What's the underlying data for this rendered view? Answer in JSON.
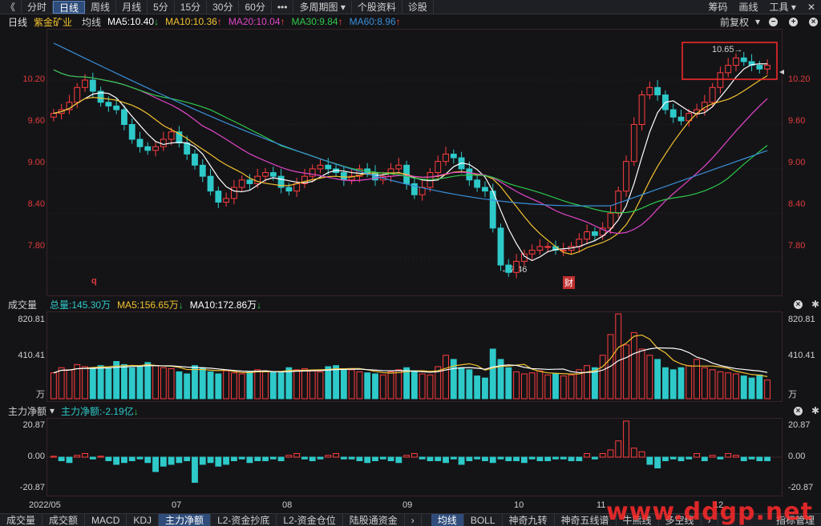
{
  "toolbar": {
    "back_icon": "《",
    "periods": [
      "分时",
      "日线",
      "周线",
      "月线",
      "5分",
      "15分",
      "30分",
      "60分"
    ],
    "active_period": "日线",
    "more_label": "•••",
    "multi_cycle_label": "多周期图",
    "stock_info_label": "个股资料",
    "diagnose_label": "诊股",
    "chips_label": "筹码",
    "draw_label": "画线",
    "tools_label": "工具"
  },
  "main_info": {
    "period": "日线",
    "stock_name": "紫金矿业",
    "ma_label": "均线",
    "ma5": "MA5:10.40",
    "ma10": "MA10:10.36",
    "ma20": "MA20:10.04",
    "ma30": "MA30:9.84",
    "ma60": "MA60:8.96",
    "adjust_label": "前复权",
    "colors": {
      "ma5": "#ffffff",
      "ma10": "#f2c12e",
      "ma20": "#e146c8",
      "ma30": "#2ec94a",
      "ma60": "#3a8fd8"
    }
  },
  "price_axis": {
    "ticks": [
      "10.20",
      "9.60",
      "9.00",
      "8.40",
      "7.80"
    ],
    "high_annotation": "10.65→",
    "low_annotation": "←7.46",
    "marker_q": "q",
    "marker_cai": "财"
  },
  "volume_info": {
    "title": "成交量",
    "total": "总量:145.30万",
    "ma5": "MA5:156.65万",
    "ma10": "MA10:172.86万",
    "ticks": [
      "820.81",
      "410.41",
      "万"
    ]
  },
  "flow_info": {
    "title": "主力净额",
    "value": "主力净额:-2.19亿",
    "ticks": [
      "20.87",
      "0.00",
      "-20.87"
    ]
  },
  "date_axis": [
    "2022/05",
    "07",
    "08",
    "09",
    "10",
    "11",
    "12"
  ],
  "bottom_tabs": [
    "成交量",
    "成交额",
    "MACD",
    "KDJ",
    "主力净额",
    "L2-资金抄底",
    "L2-资金仓位",
    "陆股通资金"
  ],
  "bottom_tabs_active": "主力净额",
  "bottom_tabs2": [
    "均线",
    "BOLL",
    "神奇九转",
    "神奇五线谱",
    "牛熊线",
    "多空线"
  ],
  "bottom_tabs2_active": "均线",
  "indicator_mgmt": "指标管理",
  "watermark": "www.ddgp.net",
  "chart_data": {
    "type": "candlestick",
    "price_range": [
      7.3,
      10.85
    ],
    "volume_range": [
      0,
      820.81
    ],
    "flow_range": [
      -20.87,
      20.87
    ],
    "price_seeds": [
      9.75,
      9.8,
      9.9,
      10.1,
      10.2,
      10.05,
      9.9,
      9.85,
      9.8,
      9.6,
      9.4,
      9.3,
      9.25,
      9.3,
      9.4,
      9.5,
      9.35,
      9.2,
      9.05,
      8.9,
      8.7,
      8.55,
      8.6,
      8.75,
      8.85,
      8.8,
      8.9,
      8.95,
      8.9,
      8.75,
      8.7,
      8.8,
      8.9,
      9.0,
      9.05,
      9.0,
      8.95,
      8.85,
      8.9,
      9.0,
      8.95,
      8.85,
      8.9,
      9.0,
      9.05,
      8.8,
      8.65,
      8.75,
      8.95,
      9.1,
      9.2,
      9.15,
      9.0,
      8.85,
      8.75,
      8.7,
      8.2,
      7.7,
      7.6,
      7.75,
      7.85,
      7.9,
      7.95,
      7.95,
      7.9,
      7.9,
      7.95,
      8.05,
      8.15,
      8.1,
      8.2,
      8.4,
      8.7,
      9.1,
      9.6,
      10.0,
      10.1,
      10.0,
      9.8,
      9.7,
      9.65,
      9.75,
      9.8,
      9.9,
      10.1,
      10.3,
      10.4,
      10.5,
      10.45,
      10.4,
      10.35,
      10.4
    ],
    "volume_seeds": [
      250,
      300,
      280,
      330,
      310,
      290,
      320,
      300,
      360,
      330,
      300,
      310,
      350,
      320,
      300,
      290,
      260,
      240,
      320,
      300,
      260,
      240,
      270,
      250,
      240,
      260,
      280,
      270,
      260,
      250,
      300,
      280,
      290,
      270,
      260,
      310,
      320,
      290,
      280,
      260,
      250,
      240,
      230,
      260,
      280,
      300,
      270,
      240,
      230,
      310,
      420,
      380,
      300,
      280,
      220,
      200,
      480,
      380,
      300,
      260,
      240,
      250,
      270,
      230,
      240,
      220,
      230,
      280,
      320,
      300,
      420,
      620,
      820,
      520,
      640,
      480,
      420,
      380,
      300,
      280,
      300,
      320,
      380,
      300,
      280,
      260,
      250,
      240,
      220,
      200,
      230,
      180
    ],
    "flow_seeds": [
      0.5,
      -2,
      -3,
      1,
      2,
      -1,
      0.5,
      -2,
      -4,
      -3,
      -2,
      -1,
      -3,
      -8,
      -5,
      -4,
      -3,
      -2,
      -14,
      -4,
      -3,
      -5,
      -4,
      -2,
      -1,
      -3,
      -2,
      -2,
      -1,
      -2,
      1,
      2,
      -1,
      -2,
      -1,
      1,
      2,
      -1,
      -1,
      -2,
      -3,
      -2,
      -1,
      -2,
      -3,
      1,
      2,
      -1,
      -2,
      -2,
      -3,
      -1,
      -4,
      -2,
      -1,
      -2,
      -3,
      -1,
      -2,
      -2,
      -3,
      -1,
      -2,
      -2,
      -1,
      -1,
      -2,
      -2,
      2,
      -1,
      2,
      4,
      9,
      20,
      5,
      3,
      -4,
      -6,
      -2,
      -1,
      -2,
      -1,
      2,
      -2,
      1,
      -1,
      2,
      1,
      -2,
      -1,
      -2,
      -2
    ]
  }
}
